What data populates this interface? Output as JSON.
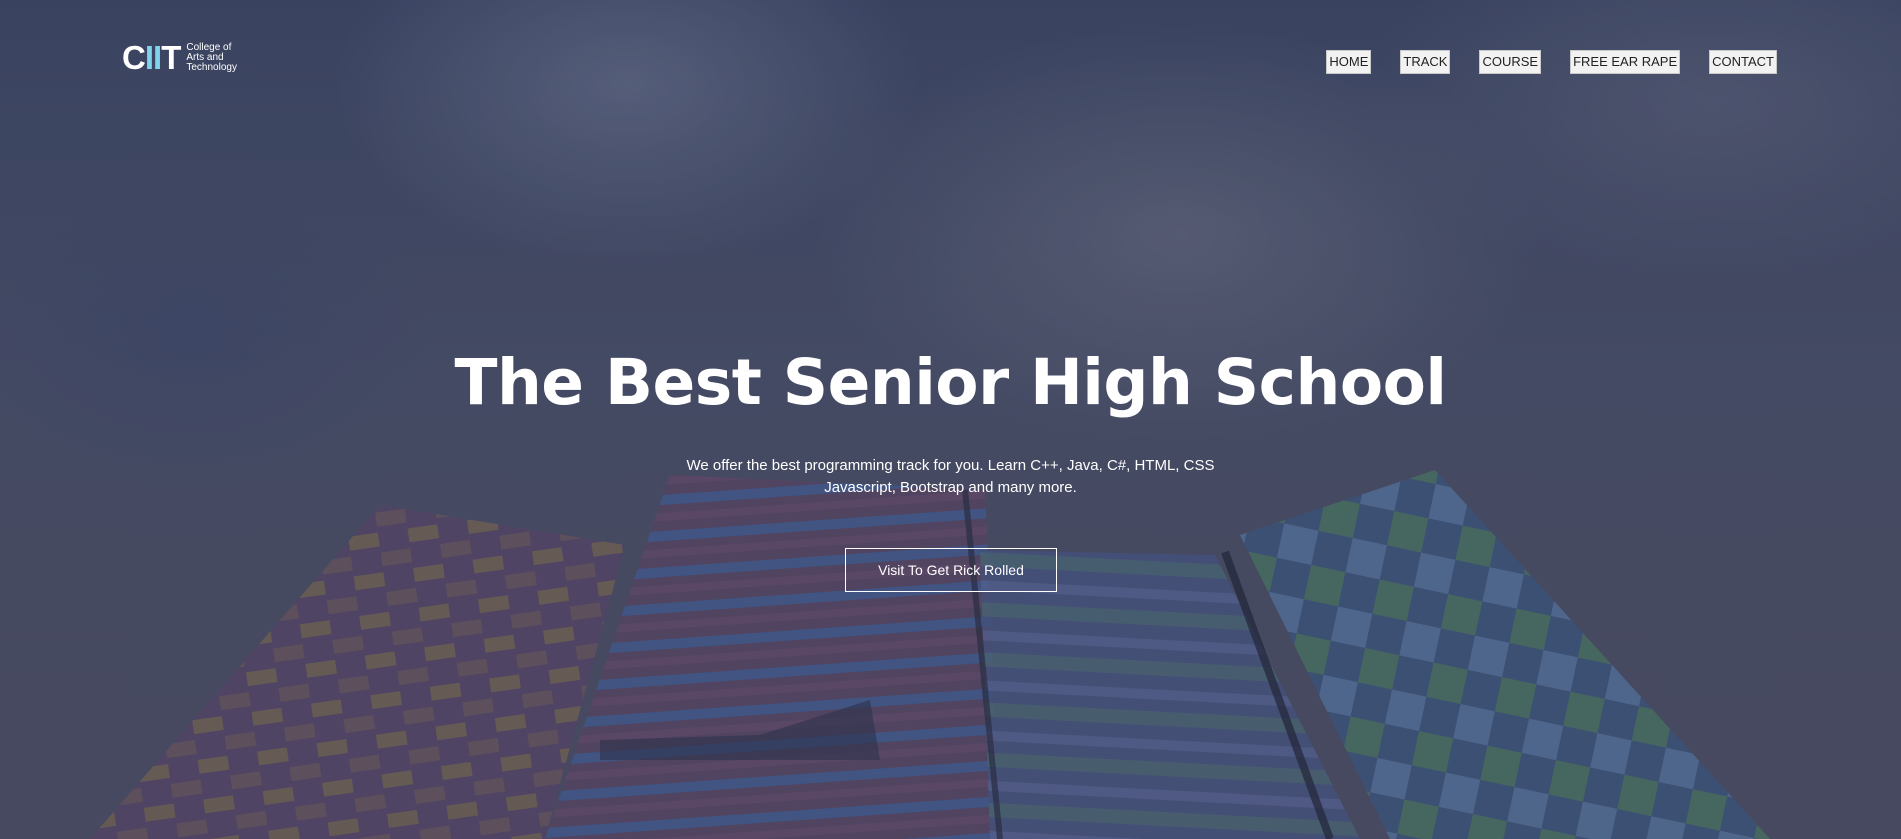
{
  "logo": {
    "mark_a": "C",
    "mark_bars": "II",
    "mark_b": "T",
    "line1": "College of",
    "line2": "Arts and",
    "line3": "Technology"
  },
  "nav": {
    "items": [
      {
        "label": "HOME"
      },
      {
        "label": "TRACK"
      },
      {
        "label": "COURSE"
      },
      {
        "label": "FREE EAR RAPE"
      },
      {
        "label": "CONTACT"
      }
    ]
  },
  "hero": {
    "title": "The Best Senior High School",
    "subtitle_line1": "We offer the best programming track for you. Learn C++, Java, C#, HTML, CSS",
    "subtitle_line2": "Javascript, Bootstrap and many more.",
    "cta_label": "Visit To Get Rick Rolled"
  },
  "colors": {
    "overlay": "#4a4f66",
    "text": "#ffffff",
    "nav_bg": "#f2f2f2",
    "logo_accent": "#7fd3ea"
  }
}
